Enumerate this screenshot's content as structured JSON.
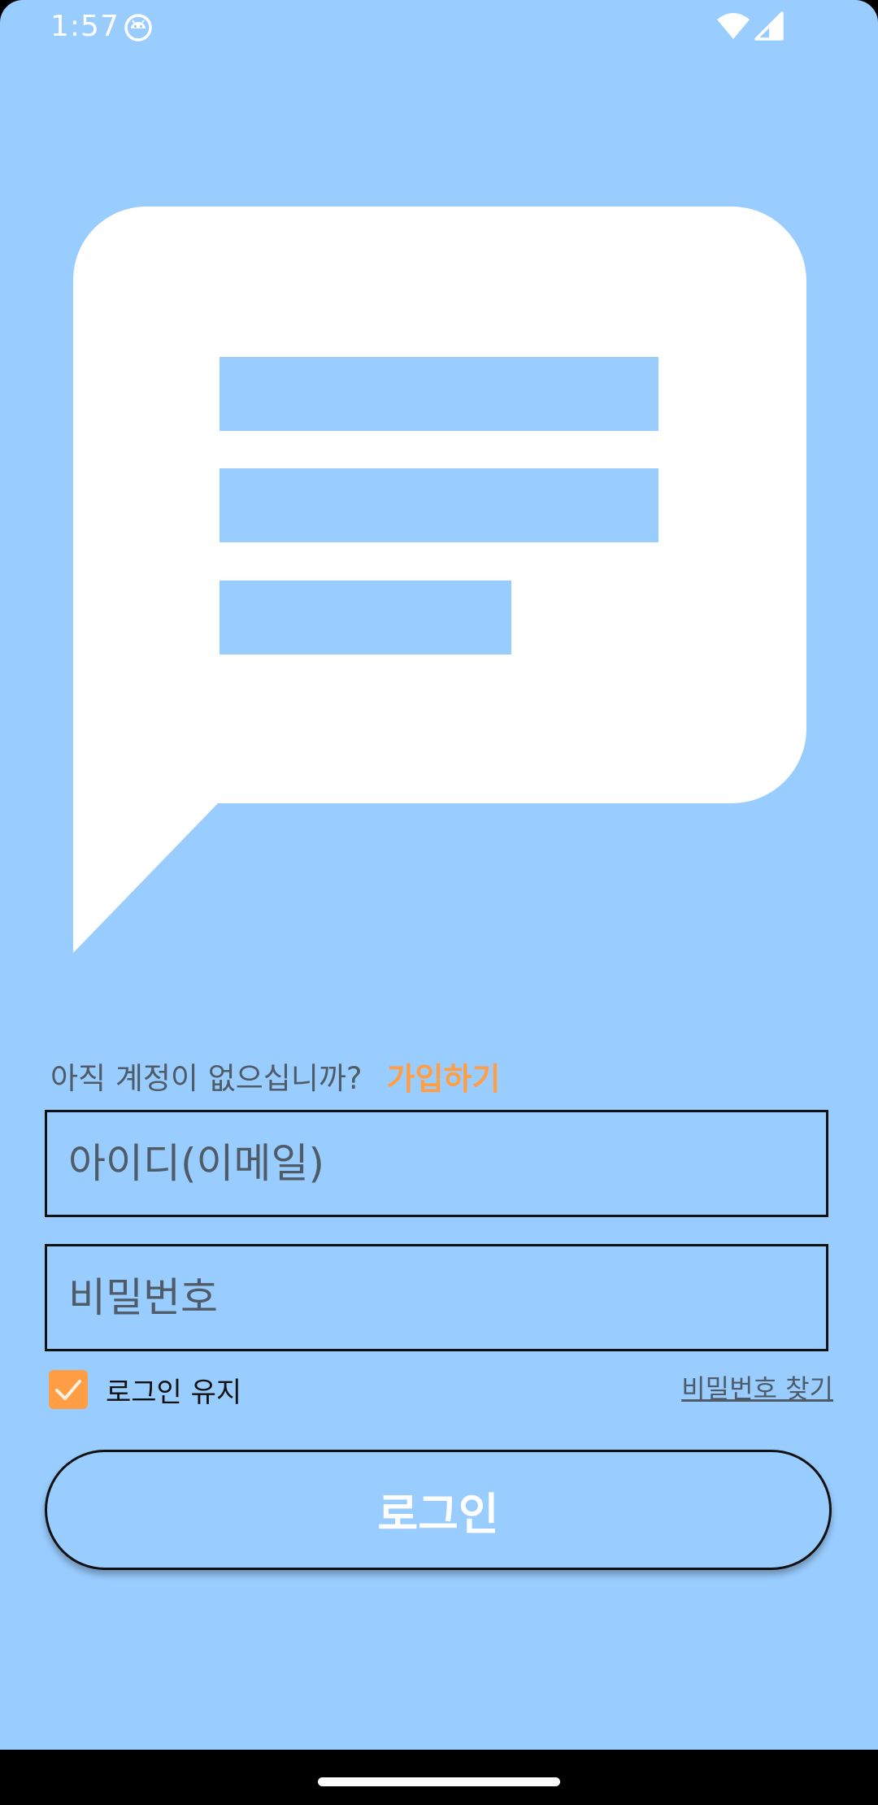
{
  "status_bar": {
    "time": "1:57",
    "icons": [
      "android-app-icon",
      "wifi-icon",
      "signal-icon"
    ]
  },
  "logo": {
    "icon": "chat-bubble-icon",
    "bubble_color": "#ffffff",
    "line_color": "#99ccff"
  },
  "signup": {
    "prompt": "아직 계정이 없으십니까?",
    "link": "가입하기"
  },
  "form": {
    "email_placeholder": "아이디(이메일)",
    "email_value": "",
    "password_placeholder": "비밀번호",
    "password_value": ""
  },
  "remember": {
    "label": "로그인 유지",
    "checked": true
  },
  "forgot_password": "비밀번호 찾기",
  "login_button": "로그인",
  "colors": {
    "background": "#99ccff",
    "accent": "#ff9e45",
    "muted_text": "#4f5b66",
    "border": "#111111"
  }
}
